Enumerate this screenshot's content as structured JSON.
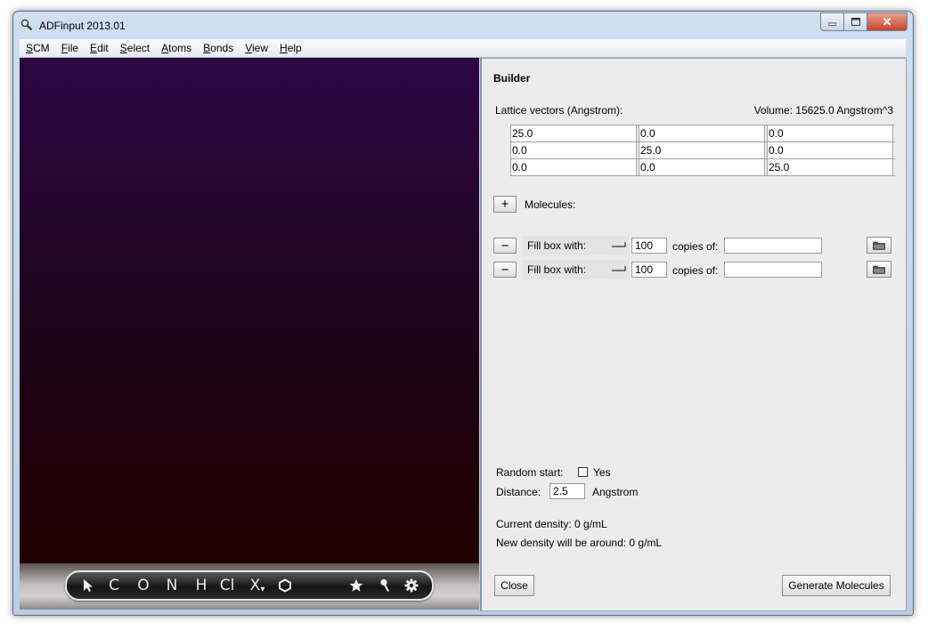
{
  "window": {
    "title": "ADFinput 2013.01",
    "controls": {
      "minimize_icon": "minimize-icon",
      "maximize_icon": "maximize-icon",
      "close_label": "✕"
    }
  },
  "menu": {
    "items": [
      {
        "mnemonic": "S",
        "rest": "CM"
      },
      {
        "mnemonic": "F",
        "rest": "ile"
      },
      {
        "mnemonic": "E",
        "rest": "dit"
      },
      {
        "mnemonic": "S",
        "rest": "elect"
      },
      {
        "mnemonic": "A",
        "rest": "toms"
      },
      {
        "mnemonic": "B",
        "rest": "onds"
      },
      {
        "mnemonic": "V",
        "rest": "iew"
      },
      {
        "mnemonic": "H",
        "rest": "elp"
      }
    ]
  },
  "toolbar": {
    "carbon": "C",
    "oxygen": "O",
    "nitrogen": "N",
    "hydrogen": "H",
    "chlorine": "Cl",
    "other_element": "X",
    "other_element_sub": "▾"
  },
  "builder": {
    "title": "Builder",
    "lattice_label": "Lattice vectors (Angstrom):",
    "volume_label": "Volume: 15625.0 Angstrom^3",
    "lattice": [
      [
        "25.0",
        "0.0",
        "0.0"
      ],
      [
        "0.0",
        "25.0",
        "0.0"
      ],
      [
        "0.0",
        "0.0",
        "25.0"
      ]
    ],
    "add_label": "+",
    "molecules_label": "Molecules:",
    "rows": [
      {
        "remove_label": "−",
        "fill_label": "Fill box with:",
        "count": "100",
        "copies_label": "copies of:",
        "molecule": ""
      },
      {
        "remove_label": "−",
        "fill_label": "Fill box with:",
        "count": "100",
        "copies_label": "copies of:",
        "molecule": ""
      }
    ],
    "random_start_label": "Random start:",
    "random_start_checked": false,
    "yes_label": "Yes",
    "distance_label": "Distance:",
    "distance_value": "2.5",
    "distance_unit": "Angstrom",
    "current_density": "Current density: 0 g/mL",
    "new_density": "New density will be around: 0 g/mL",
    "close_button": "Close",
    "generate_button": "Generate Molecules"
  }
}
